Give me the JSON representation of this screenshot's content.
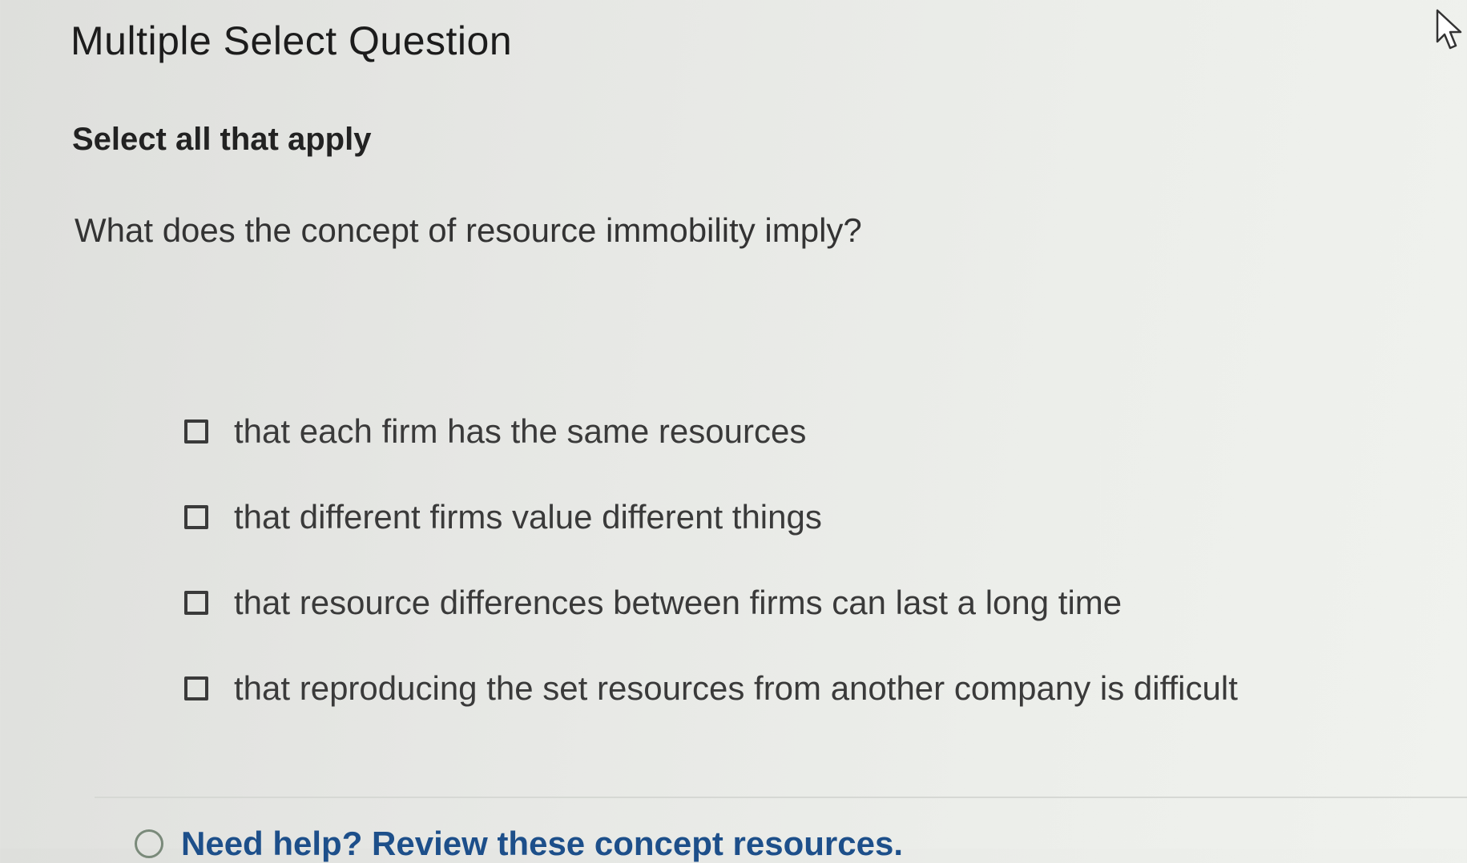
{
  "question": {
    "type_label": "Multiple Select Question",
    "instruction": "Select all that apply",
    "prompt": "What does the concept of resource immobility imply?"
  },
  "options": [
    {
      "label": "that each firm has the same resources",
      "checked": false
    },
    {
      "label": "that different firms value different things",
      "checked": false
    },
    {
      "label": "that resource differences between firms can last a long time",
      "checked": false
    },
    {
      "label": "that reproducing the set resources from another company is difficult",
      "checked": false
    }
  ],
  "help": {
    "icon": "chevron-down-circle-icon",
    "label": "Need help? Review these concept resources."
  },
  "cursor": {
    "icon": "mouse-pointer-icon"
  }
}
